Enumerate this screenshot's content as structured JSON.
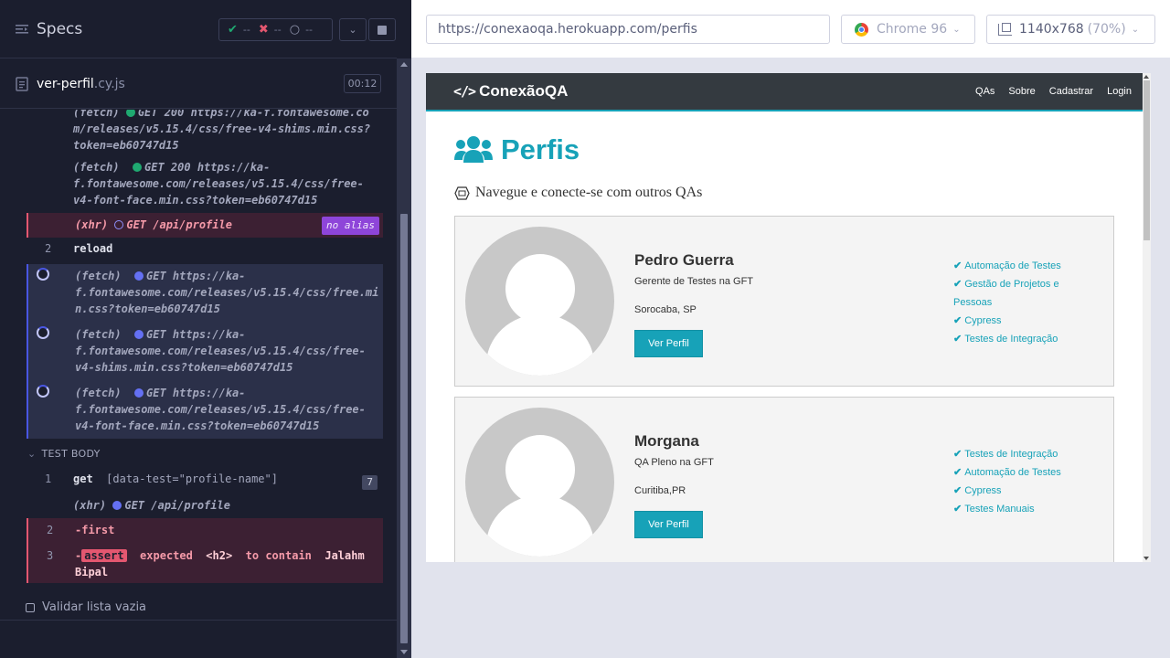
{
  "reporter": {
    "title": "Specs",
    "stats": {
      "passed": "--",
      "failed": "--",
      "pending": "--"
    },
    "spec_file": {
      "name": "ver-perfil",
      "ext": ".cy.js",
      "time": "00:12"
    }
  },
  "commands": {
    "c0_line1": "(fetch)",
    "c0_text": "GET 200 https://ka-f.fontawesome.com/releases/v5.15.4/css/free-v4-shims.min.css?token=eb60747d15",
    "c1_label": "(fetch)",
    "c1_text": "GET 200 https://ka-",
    "c1_line2": "f.fontawesome.com/releases/v5.15.4/css/free-",
    "c1_line3": "v4-font-face.min.css?token=eb60747d15",
    "xhr1_label": "(xhr)",
    "xhr1_text": "GET /api/profile",
    "xhr1_alias": "no alias",
    "reload_num": "2",
    "reload_text": "reload",
    "p1_label": "(fetch)",
    "p1_l1": "GET https://ka-",
    "p1_l2": "f.fontawesome.com/releases/v5.15.4/css/free.mi",
    "p1_l3": "n.css?token=eb60747d15",
    "p2_label": "(fetch)",
    "p2_l1": "GET https://ka-",
    "p2_l2": "f.fontawesome.com/releases/v5.15.4/css/free-",
    "p2_l3": "v4-shims.min.css?token=eb60747d15",
    "p3_label": "(fetch)",
    "p3_l1": "GET https://ka-",
    "p3_l2": "f.fontawesome.com/releases/v5.15.4/css/free-",
    "p3_l3": "v4-font-face.min.css?token=eb60747d15",
    "section": "TEST BODY",
    "get_num": "1",
    "get_cmd": "get",
    "get_arg": "[data-test=\"profile-name\"]",
    "get_count": "7",
    "xhr2_label": "(xhr)",
    "xhr2_text": "GET /api/profile",
    "first_num": "2",
    "first_text": "-first",
    "assert_num": "3",
    "assert_dash": "-",
    "assert_tag": "assert",
    "assert_expected": "expected",
    "assert_el": "<h2>",
    "assert_contain": "to contain",
    "assert_val1": "Jalahm",
    "assert_val2": "Bipal",
    "suite": "Validar lista vazia"
  },
  "runner": {
    "url": "https://conexaoqa.herokuapp.com/perfis",
    "browser": "Chrome 96",
    "viewport": "1140x768",
    "zoom": "(70%)"
  },
  "app": {
    "brand": "ConexãoQA",
    "nav": [
      "QAs",
      "Sobre",
      "Cadastrar",
      "Login"
    ],
    "title": "Perfis",
    "lead": "Navegue e conecte-se com outros QAs",
    "profiles": [
      {
        "name": "Pedro Guerra",
        "role": "Gerente de Testes na GFT",
        "location": "Sorocaba, SP",
        "button": "Ver Perfil",
        "skills": [
          "Automação de Testes",
          "Gestão de Projetos e",
          "Pessoas",
          "Cypress",
          "Testes de Integração"
        ]
      },
      {
        "name": "Morgana",
        "role": "QA Pleno na GFT",
        "location": "Curitiba,PR",
        "button": "Ver Perfil",
        "skills": [
          "Testes de Integração",
          "Automação de Testes",
          "Cypress",
          "Testes Manuais"
        ]
      }
    ]
  },
  "colors": {
    "accent": "#17a2b8",
    "reporter_bg": "#1b1e2e",
    "fail": "#e45770",
    "pending": "#4956e3"
  },
  "icons": [
    "specs-icon",
    "file-icon",
    "chrome-icon",
    "ruler-icon",
    "code-icon",
    "users-icon",
    "check-icon"
  ]
}
